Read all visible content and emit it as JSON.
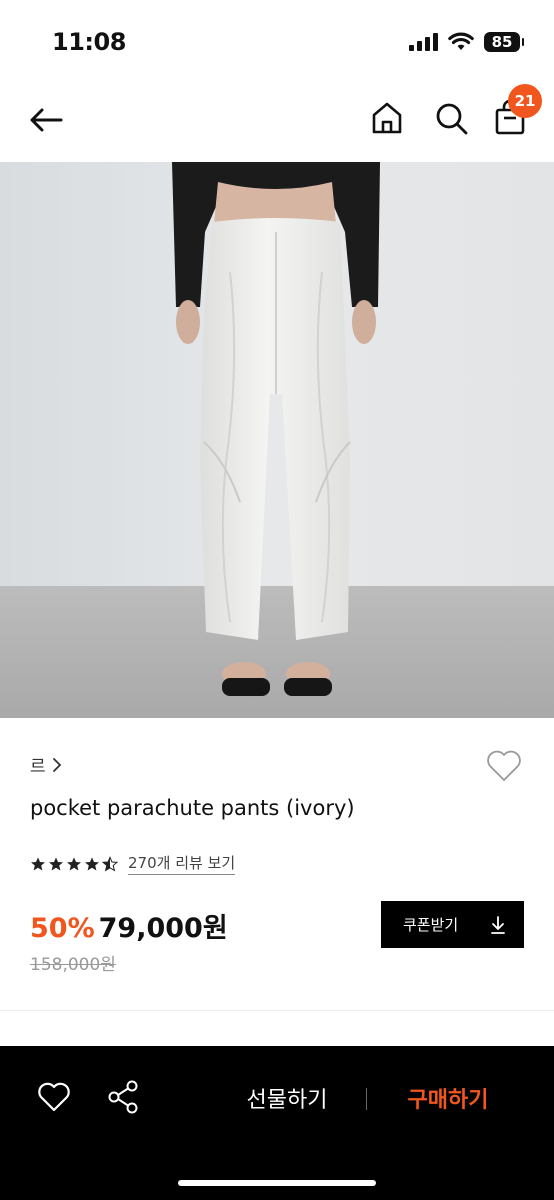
{
  "status_bar": {
    "time": "11:08",
    "battery": "85"
  },
  "nav": {
    "back_icon": "arrow-left-icon",
    "home_icon": "home-icon",
    "search_icon": "search-icon",
    "bag_icon": "shopping-bag-icon",
    "bag_badge": "21",
    "badge_color": "#f0561d"
  },
  "product": {
    "brand": "르",
    "name": "pocket parachute pants (ivory)",
    "rating": 4.5,
    "review_link": "270개 리뷰 보기",
    "discount": "50%",
    "price": "79,000원",
    "original_price": "158,000원",
    "coupon_label": "쿠폰받기"
  },
  "bottom_bar": {
    "gift_label": "선물하기",
    "buy_label": "구매하기",
    "accent_color": "#f0561d"
  }
}
